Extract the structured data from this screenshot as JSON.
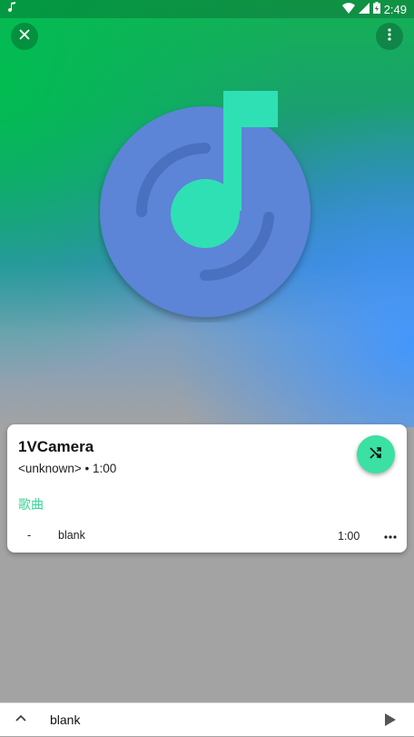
{
  "status_bar": {
    "notification_icon": "music-note-icon",
    "time": "2:49",
    "icons": [
      "wifi-icon",
      "signal-icon",
      "battery-charging-icon"
    ]
  },
  "header": {
    "close_icon": "close-icon",
    "menu_icon": "more-vert-icon"
  },
  "album_art": {
    "icon": "music-disc-icon"
  },
  "card": {
    "title": "1VCamera",
    "subtitle": "<unknown> • 1:00",
    "section_label": "歌曲",
    "accent_color": "#3bd397",
    "shuffle_icon": "shuffle-icon",
    "tracks": [
      {
        "index": "-",
        "name": "blank",
        "duration": "1:00",
        "more_icon": "more-horiz-icon"
      }
    ]
  },
  "mini_player": {
    "expand_icon": "chevron-up-icon",
    "track": "blank",
    "play_icon": "play-icon"
  }
}
